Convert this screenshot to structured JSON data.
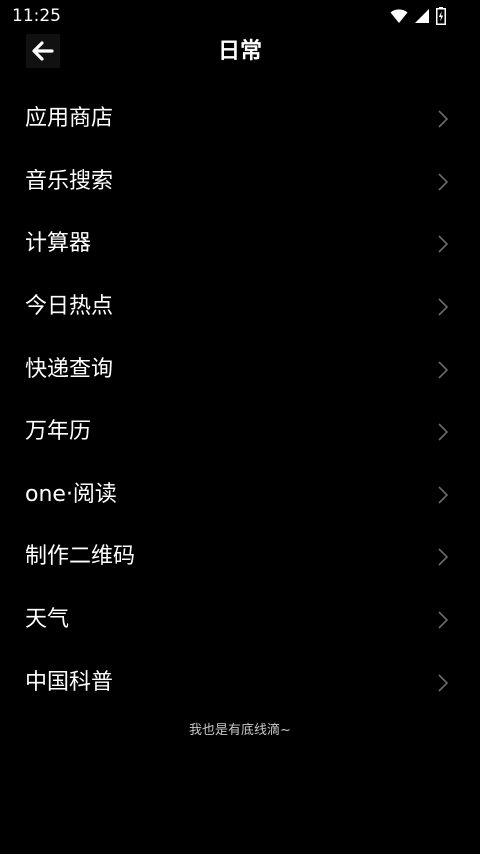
{
  "status_bar": {
    "time": "11:25",
    "icons": [
      "wifi-icon",
      "cell-signal-icon",
      "battery-charging-icon"
    ]
  },
  "header": {
    "back_icon": "arrow-left-icon",
    "title": "日常"
  },
  "menu": {
    "items": [
      {
        "label": "应用商店"
      },
      {
        "label": "音乐搜索"
      },
      {
        "label": "计算器"
      },
      {
        "label": "今日热点"
      },
      {
        "label": "快递查询"
      },
      {
        "label": "万年历"
      },
      {
        "label": "one·阅读"
      },
      {
        "label": "制作二维码"
      },
      {
        "label": "天气"
      },
      {
        "label": "中国科普"
      }
    ],
    "chevron_icon": "chevron-right-icon",
    "chevron_color": "#6a6a6a"
  },
  "footer": {
    "note": "我也是有底线滴~"
  },
  "colors": {
    "background": "#000000",
    "text": "#ffffff",
    "muted_text": "#c8c8c8"
  }
}
